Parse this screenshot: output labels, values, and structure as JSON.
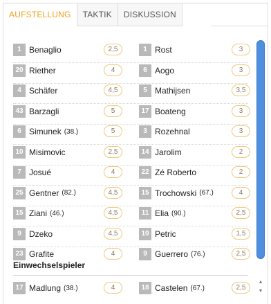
{
  "tabs": [
    {
      "label": "AUFSTELLUNG",
      "active": true
    },
    {
      "label": "TAKTIK",
      "active": false
    },
    {
      "label": "DISKUSSION",
      "active": false
    }
  ],
  "lineup": [
    {
      "left": {
        "num": "1",
        "name": "Benaglio",
        "minute": "",
        "rating": "2,5"
      },
      "right": {
        "num": "1",
        "name": "Rost",
        "minute": "",
        "rating": "3"
      }
    },
    {
      "left": {
        "num": "20",
        "name": "Riether",
        "minute": "",
        "rating": "4"
      },
      "right": {
        "num": "6",
        "name": "Aogo",
        "minute": "",
        "rating": "3"
      }
    },
    {
      "left": {
        "num": "4",
        "name": "Schäfer",
        "minute": "",
        "rating": "4,5"
      },
      "right": {
        "num": "5",
        "name": "Mathijsen",
        "minute": "",
        "rating": "3,5"
      }
    },
    {
      "left": {
        "num": "43",
        "name": "Barzagli",
        "minute": "",
        "rating": "5"
      },
      "right": {
        "num": "17",
        "name": "Boateng",
        "minute": "",
        "rating": "3"
      }
    },
    {
      "left": {
        "num": "6",
        "name": "Simunek",
        "minute": "(38.)",
        "rating": "5"
      },
      "right": {
        "num": "3",
        "name": "Rozehnal",
        "minute": "",
        "rating": "3"
      }
    },
    {
      "left": {
        "num": "10",
        "name": "Misimovic",
        "minute": "",
        "rating": "2,5"
      },
      "right": {
        "num": "14",
        "name": "Jarolim",
        "minute": "",
        "rating": "2"
      }
    },
    {
      "left": {
        "num": "7",
        "name": "Josué",
        "minute": "",
        "rating": "4"
      },
      "right": {
        "num": "22",
        "name": "Zé Roberto",
        "minute": "",
        "rating": "2"
      }
    },
    {
      "left": {
        "num": "25",
        "name": "Gentner",
        "minute": "(82.)",
        "rating": "4,5"
      },
      "right": {
        "num": "15",
        "name": "Trochowski",
        "minute": "(67.)",
        "rating": "4"
      }
    },
    {
      "left": {
        "num": "15",
        "name": "Ziani",
        "minute": "(46.)",
        "rating": "4,5"
      },
      "right": {
        "num": "11",
        "name": "Elia",
        "minute": "(90.)",
        "rating": "2,5"
      }
    },
    {
      "left": {
        "num": "9",
        "name": "Dzeko",
        "minute": "",
        "rating": "4,5"
      },
      "right": {
        "num": "10",
        "name": "Petric",
        "minute": "",
        "rating": "1,5"
      }
    },
    {
      "left": {
        "num": "23",
        "name": "Grafite",
        "minute": "",
        "rating": "4"
      },
      "right": {
        "num": "9",
        "name": "Guerrero",
        "minute": "(76.)",
        "rating": "2,5"
      }
    }
  ],
  "subs_title": "Einwechselspieler",
  "subs": [
    {
      "left": {
        "num": "17",
        "name": "Madlung",
        "minute": "(38.)",
        "rating": "4"
      },
      "right": {
        "num": "18",
        "name": "Castelen",
        "minute": "(67.)",
        "rating": "2,5"
      }
    }
  ],
  "colors": {
    "accent": "#f0a21a",
    "number_badge": "#b9b9b9",
    "rating_border": "#f1c77d",
    "scroll_thumb": "#4f8fe0"
  },
  "icons": {
    "scroll_up": "triangle-up-icon",
    "scroll_down": "triangle-down-icon"
  }
}
